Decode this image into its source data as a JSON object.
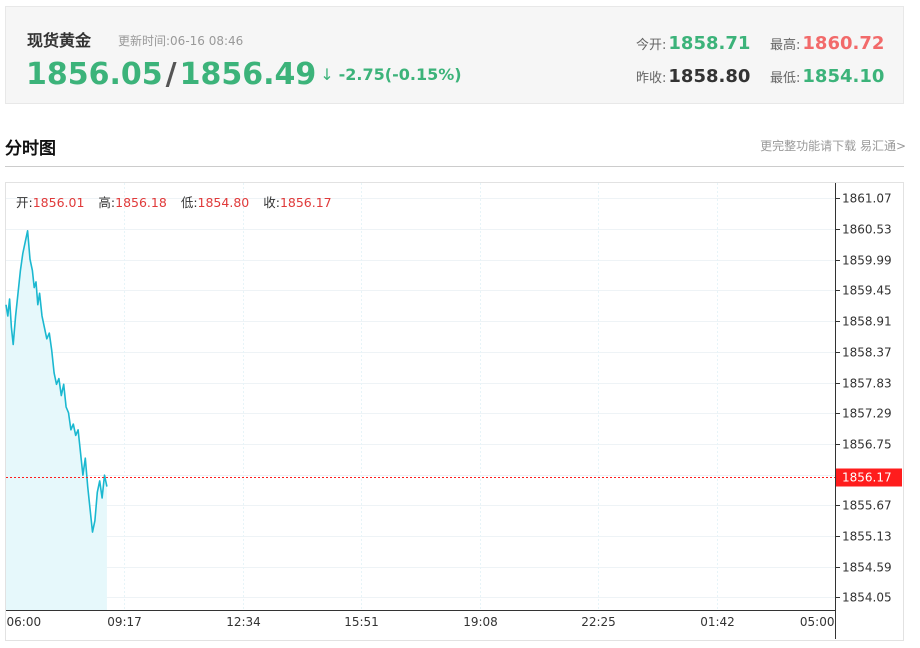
{
  "header": {
    "name": "现货黄金",
    "update_label": "更新时间:",
    "update_time": "06-16 08:46",
    "bid": "1856.05",
    "ask": "1856.49",
    "arrow": "↓",
    "change": "-2.75(-0.15%)",
    "open_label": "今开:",
    "open_value": "1858.71",
    "high_label": "最高:",
    "high_value": "1860.72",
    "prev_close_label": "昨收:",
    "prev_close_value": "1858.80",
    "low_label": "最低:",
    "low_value": "1854.10"
  },
  "colors": {
    "up": "#f26a6a",
    "down": "#3cb37a",
    "line": "#1bb8d0",
    "price_tag": "#ff1d1d",
    "ohlc_value": "#e03a3a"
  },
  "section": {
    "title": "分时图",
    "note": "更完整功能请下载 易汇通>"
  },
  "ohlc": {
    "open_label": "开:",
    "open_value": "1856.01",
    "high_label": "高:",
    "high_value": "1856.18",
    "low_label": "低:",
    "low_value": "1854.80",
    "close_label": "收:",
    "close_value": "1856.17"
  },
  "chart_data": {
    "type": "area",
    "title": "",
    "xlabel": "",
    "ylabel": "",
    "x_ticks": [
      "06:00",
      "09:17",
      "12:34",
      "15:51",
      "19:08",
      "22:25",
      "01:42",
      "05:00"
    ],
    "y_ticks": [
      "1861.07",
      "1860.53",
      "1859.99",
      "1859.45",
      "1858.91",
      "1858.37",
      "1857.83",
      "1857.29",
      "1856.75",
      "1856.21",
      "1855.67",
      "1855.13",
      "1854.59",
      "1854.05"
    ],
    "ylim": [
      1853.83,
      1861.34
    ],
    "x_axis_minutes": [
      0,
      1380
    ],
    "current_price": 1856.17,
    "current_price_label": "1856.17",
    "grid": true,
    "series": [
      {
        "x": [
          0,
          3,
          6,
          9,
          12,
          16,
          20,
          24,
          28,
          32,
          36,
          40,
          44,
          47,
          50,
          53,
          56,
          60,
          64,
          68,
          72,
          76,
          80,
          84,
          88,
          92,
          96,
          100,
          104,
          108,
          112,
          116,
          120,
          124,
          128,
          132,
          136,
          140,
          144,
          148,
          152,
          156,
          160,
          164,
          168
        ],
        "y": [
          1859.2,
          1859.0,
          1859.3,
          1858.8,
          1858.5,
          1859.0,
          1859.4,
          1859.8,
          1860.1,
          1860.3,
          1860.5,
          1860.0,
          1859.8,
          1859.5,
          1859.6,
          1859.2,
          1859.4,
          1859.0,
          1858.8,
          1858.6,
          1858.7,
          1858.4,
          1858.0,
          1857.8,
          1857.9,
          1857.6,
          1857.8,
          1857.4,
          1857.3,
          1857.0,
          1857.1,
          1856.9,
          1857.0,
          1856.6,
          1856.2,
          1856.5,
          1856.0,
          1855.6,
          1855.2,
          1855.4,
          1855.9,
          1856.1,
          1855.8,
          1856.2,
          1856.0
        ]
      }
    ]
  }
}
